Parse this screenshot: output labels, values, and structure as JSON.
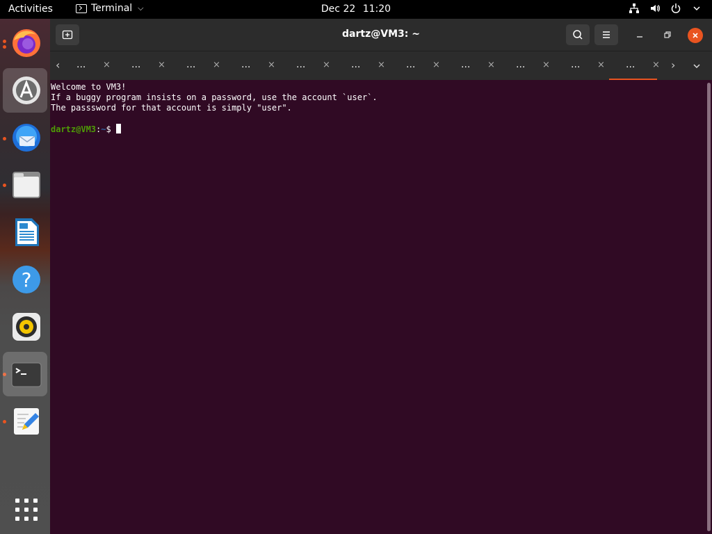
{
  "topbar": {
    "activities": "Activities",
    "app_name": "Terminal",
    "date": "Dec 22",
    "time": "11:20"
  },
  "dock": {
    "items": [
      {
        "name": "firefox-icon"
      },
      {
        "name": "software-center-icon"
      },
      {
        "name": "thunderbird-icon"
      },
      {
        "name": "files-icon"
      },
      {
        "name": "libreoffice-writer-icon"
      },
      {
        "name": "help-icon"
      },
      {
        "name": "rhythmbox-icon"
      },
      {
        "name": "terminal-icon"
      },
      {
        "name": "text-editor-icon"
      },
      {
        "name": "show-apps-icon"
      }
    ]
  },
  "window": {
    "title": "dartz@VM3: ~"
  },
  "tabs": {
    "labels": [
      "...",
      "...",
      "...",
      "...",
      "...",
      "...",
      "...",
      "...",
      "...",
      "...",
      "..."
    ],
    "close_glyph": "×"
  },
  "terminal": {
    "lines": [
      "Welcome to VM3!",
      "If a buggy program insists on a password, use the account `user`.",
      "The passsword for that account is simply \"user\"."
    ],
    "prompt_user": "dartz@VM3",
    "prompt_sep": ":",
    "prompt_dir": "~",
    "prompt_sym": "$ "
  },
  "colors": {
    "accent": "#e95420",
    "terminal_bg": "#300a24",
    "prompt_green": "#4e9a06",
    "prompt_blue": "#3465a4"
  }
}
